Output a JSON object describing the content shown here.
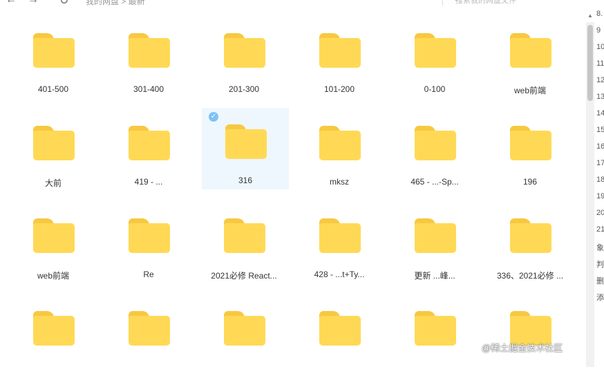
{
  "topbar": {
    "back": "←",
    "forward": "→",
    "refresh": "↻",
    "breadcrumb": "我的网盘 > 最新",
    "search_placeholder": "搜索我的网盘文件",
    "search_icon": "search-icon"
  },
  "items": [
    {
      "label": "401-500",
      "selected": false
    },
    {
      "label": "301-400",
      "selected": false
    },
    {
      "label": "201-300",
      "selected": false
    },
    {
      "label": "101-200",
      "selected": false
    },
    {
      "label": "0-100",
      "selected": false
    },
    {
      "label": "web前端",
      "selected": false
    },
    {
      "label": "大前",
      "selected": false
    },
    {
      "label": "419 - ...",
      "selected": false
    },
    {
      "label": "316",
      "selected": true
    },
    {
      "label": "mksz",
      "selected": false
    },
    {
      "label": "465 - ...-Sp...",
      "selected": false
    },
    {
      "label": "196",
      "selected": false
    },
    {
      "label": "web前端",
      "selected": false
    },
    {
      "label": "Re",
      "selected": false
    },
    {
      "label": "2021必修 React...",
      "selected": false
    },
    {
      "label": "428 - ...t+Ty...",
      "selected": false
    },
    {
      "label": "更新 ...峰...",
      "selected": false
    },
    {
      "label": "336、2021必修 ...",
      "selected": false
    },
    {
      "label": "",
      "selected": false
    },
    {
      "label": "",
      "selected": false
    },
    {
      "label": "",
      "selected": false
    },
    {
      "label": "",
      "selected": false
    },
    {
      "label": "",
      "selected": false
    },
    {
      "label": "",
      "selected": false
    }
  ],
  "side_numbers": [
    "8.",
    "9",
    "10",
    "11",
    "12",
    "13",
    "14",
    "15",
    "16",
    "17",
    "18",
    "19",
    "20",
    "21",
    "象",
    "判",
    "删",
    "添"
  ],
  "watermark": "@稀土掘金技术社区",
  "colors": {
    "folder": "#ffd955",
    "folder_tab": "#f7c841",
    "selected_bg": "#eef7fd",
    "check": "#7fc2f5"
  }
}
